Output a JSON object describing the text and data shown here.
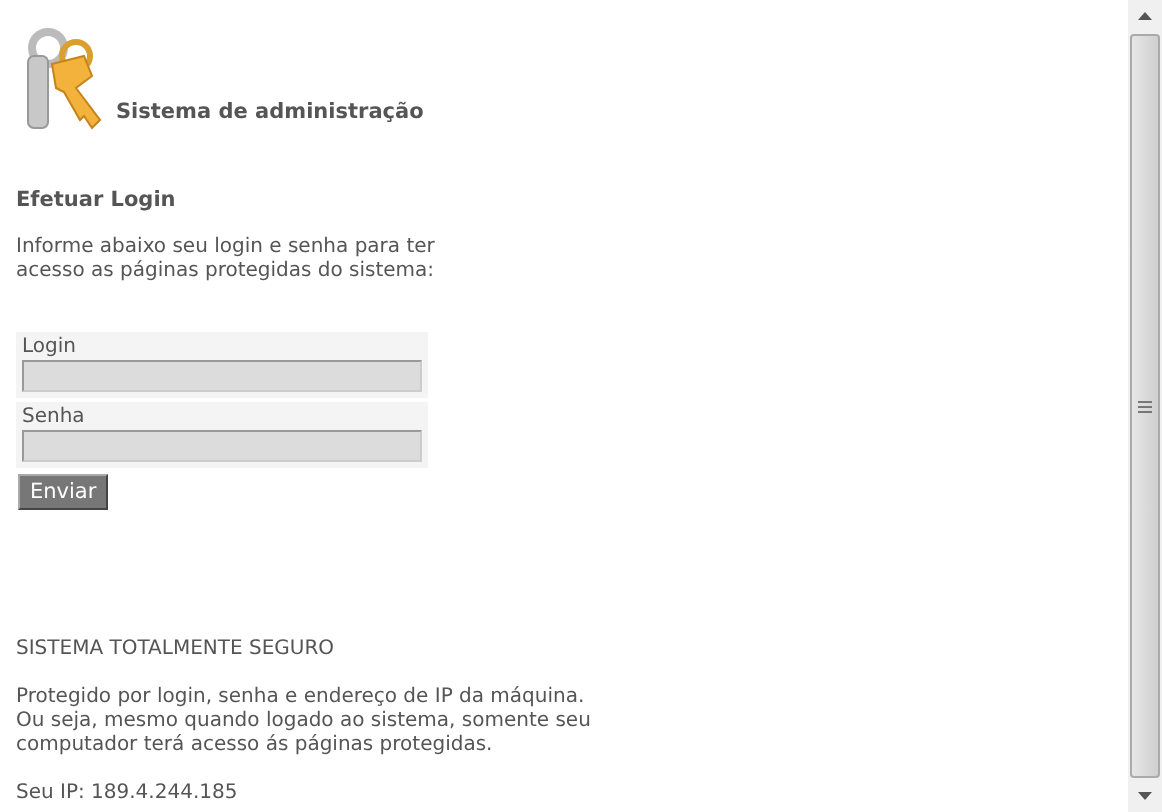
{
  "header": {
    "title": "Sistema de administração"
  },
  "login": {
    "heading": "Efetuar Login",
    "intro": "Informe abaixo seu login e senha para ter acesso as páginas protegidas do sistema:",
    "fields": [
      {
        "label": "Login"
      },
      {
        "label": "Senha"
      }
    ],
    "button": "Enviar"
  },
  "security": {
    "heading": "SISTEMA TOTALMENTE SEGURO",
    "text": "Protegido por login, senha e endereço de IP da máquina. Ou seja, mesmo quando logado ao sistema, somente seu computador terá acesso ás páginas protegidas.",
    "ip": "Seu IP: 189.4.244.185"
  }
}
